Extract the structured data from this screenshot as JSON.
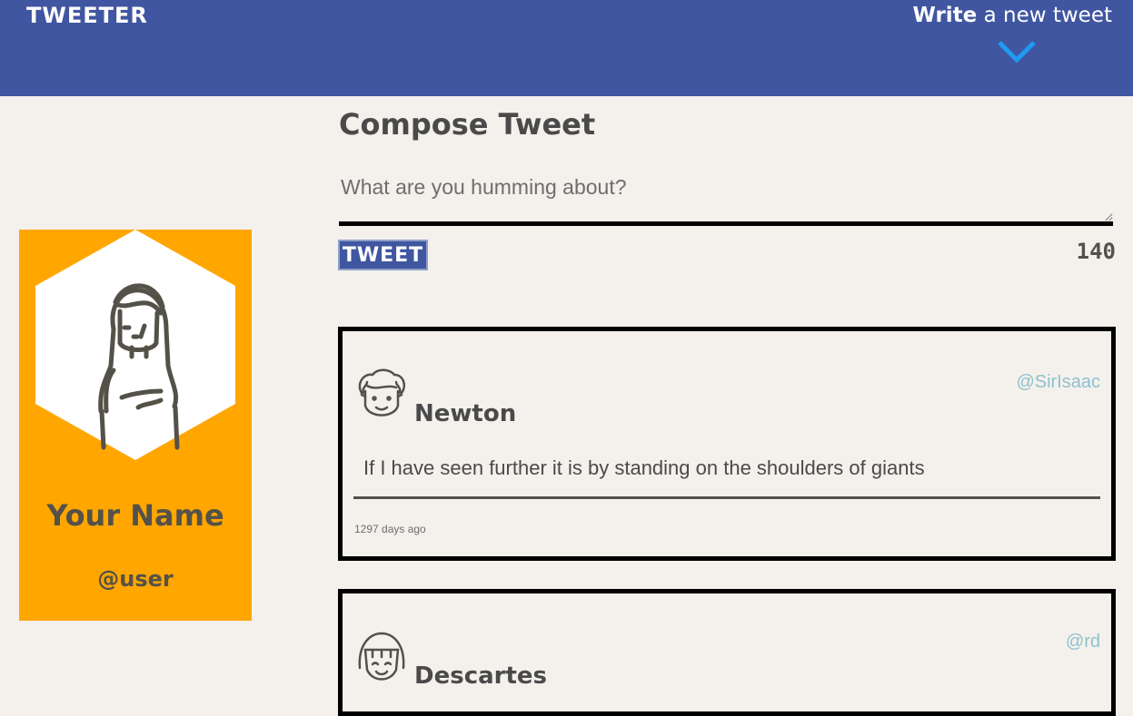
{
  "header": {
    "brand": "TWEETER",
    "write_bold": "Write",
    "write_rest": " a new tweet"
  },
  "profile": {
    "name": "Your Name",
    "handle": "@user"
  },
  "compose": {
    "title": "Compose Tweet",
    "placeholder": "What are you humming about?",
    "button_label": "TWEET",
    "counter": "140"
  },
  "tweets": [
    {
      "author": "Newton",
      "handle": "@SirIsaac",
      "text": "If I have seen further it is by standing on the shoulders of giants",
      "timestamp": "1297 days ago"
    },
    {
      "author": "Descartes",
      "handle": "@rd"
    }
  ],
  "colors": {
    "header_bg": "#4056a1",
    "page_bg": "#f4f1ec",
    "profile_bg": "#ffa600",
    "accent_chevron": "#1e9bf0",
    "handle_color": "#8fc1cf"
  }
}
